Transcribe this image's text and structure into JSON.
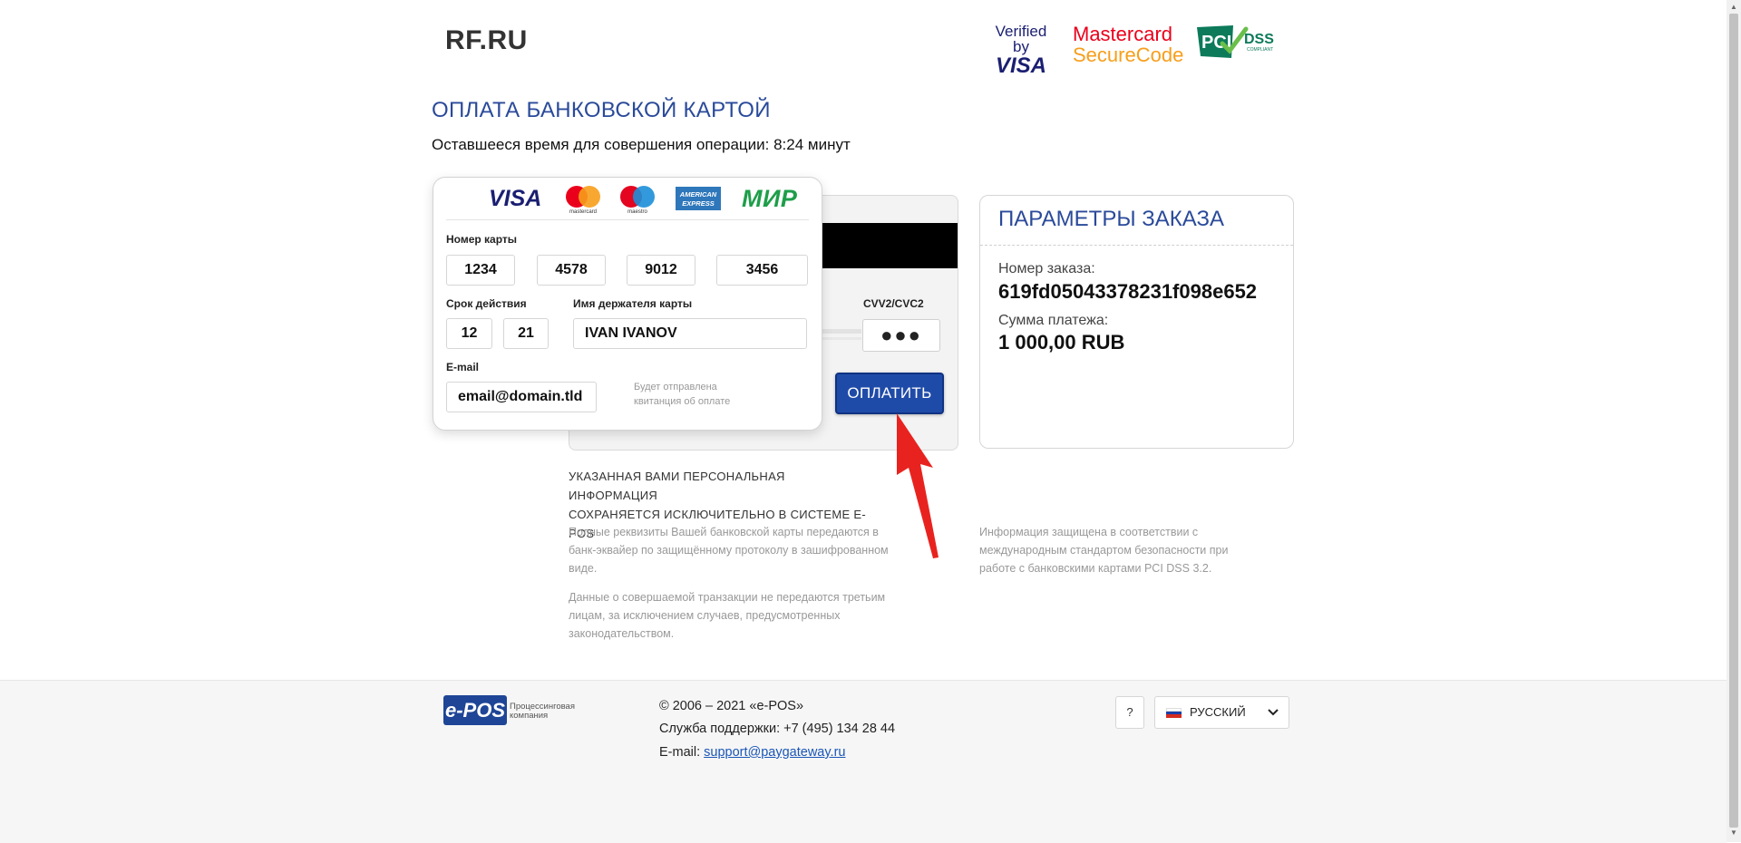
{
  "header": {
    "merchant_logo": "RF.RU",
    "badges": {
      "visa_line1": "Verified by",
      "visa_line2": "VISA",
      "mc_line1": "Mastercard",
      "mc_line2": "SecureCode",
      "pci_main": "PCI",
      "pci_dss": "DSS",
      "pci_sub": "COMPLIANT"
    }
  },
  "payment": {
    "title": "ОПЛАТА БАНКОВСКОЙ КАРТОЙ",
    "timer_text": "Оставшееся время для совершения операции: 8:24 минут"
  },
  "card_brands": {
    "visa": "VISA",
    "mastercard": "mastercard",
    "maestro": "maestro",
    "amex_line1": "AMERICAN",
    "amex_line2": "EXPRESS",
    "mir": "МИР"
  },
  "form": {
    "card_number_label": "Номер карты",
    "card_number": [
      "1234",
      "4578",
      "9012",
      "3456"
    ],
    "expiry_label": "Срок действия",
    "expiry_month": "12",
    "expiry_year": "21",
    "holder_label": "Имя держателя карты",
    "holder_value": "IVAN IVANOV",
    "email_label": "E-mail",
    "email_value": "email@domain.tld",
    "email_hint_line1": "Будет отправлена",
    "email_hint_line2": "квитанция об оплате",
    "cvv_label": "CVV2/CVC2",
    "cvv_value": "●●●",
    "pay_button": "ОПЛАТИТЬ"
  },
  "order": {
    "heading": "ПАРАМЕТРЫ ЗАКАЗА",
    "order_number_label": "Номер заказа:",
    "order_number": "619fd05043378231f098e652",
    "amount_label": "Сумма платежа:",
    "amount": "1 000,00 RUB"
  },
  "info": {
    "personal_line1": "УКАЗАННАЯ ВАМИ ПЕРСОНАЛЬНАЯ ИНФОРМАЦИЯ",
    "personal_line2": "СОХРАНЯЕТСЯ ИСКЛЮЧИТЕЛЬНО В СИСТЕМЕ E-POS",
    "p1_line1": "Полные реквизиты Вашей банковской карты передаются в",
    "p1_line2": "банк-эквайер по защищённому протоколу в зашифрованном",
    "p1_line3": "виде.",
    "p2_line1": "Данные о совершаемой транзакции не передаются третьим",
    "p2_line2": "лицам, за исключением случаев, предусмотренных",
    "p2_line3": "законодательством.",
    "p3_line1": "Информация защищена в соответствии с",
    "p3_line2": "международным стандартом безопасности при",
    "p3_line3": "работе с банковскими картами PCI DSS 3.2."
  },
  "footer": {
    "logo": "e-POS",
    "logo_sub_line1": "Процессинговая",
    "logo_sub_line2": "компания",
    "copyright": "© 2006 – 2021 «e-POS»",
    "support": "Служба поддержки: +7 (495) 134 28 44",
    "email_label": "E-mail:",
    "email_link": "support@paygateway.ru",
    "help_button": "?",
    "language": "РУССКИЙ"
  },
  "colors": {
    "accent_blue": "#2a4a9a",
    "button_blue": "#1f4ba8",
    "arrow_red": "#e8231f"
  }
}
